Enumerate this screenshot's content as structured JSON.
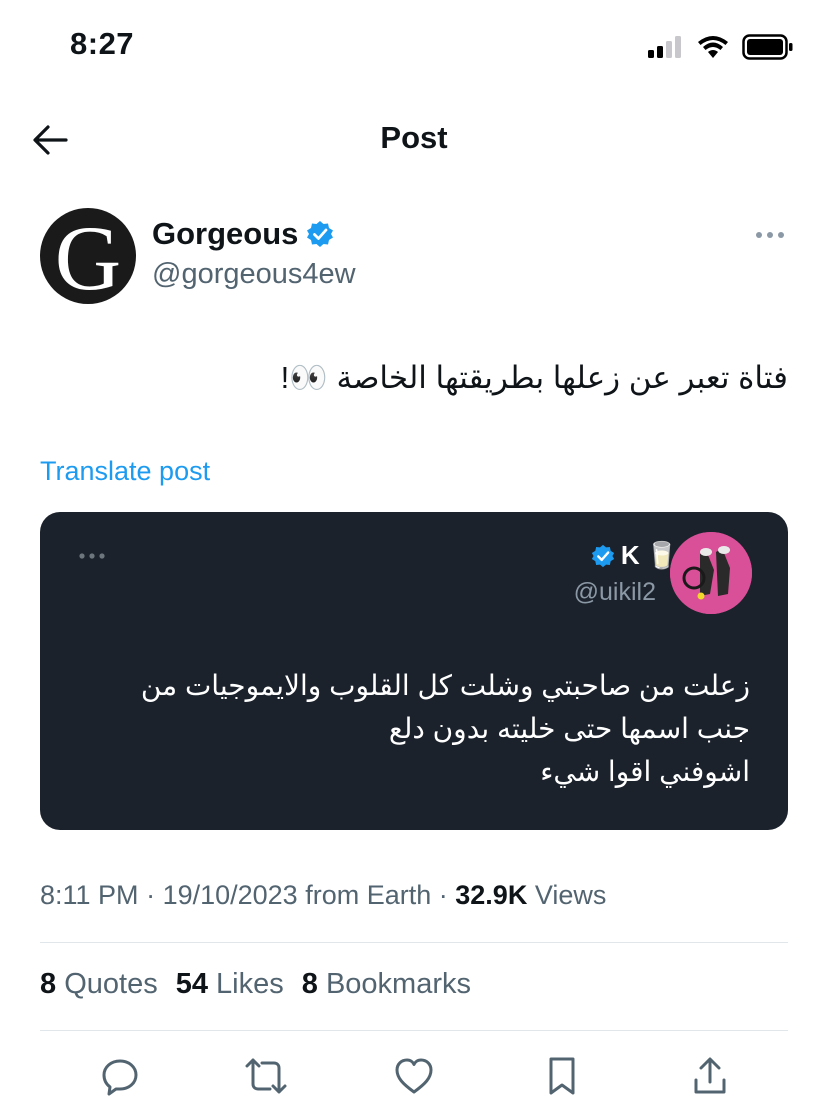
{
  "status_bar": {
    "time": "8:27"
  },
  "header": {
    "title": "Post"
  },
  "post": {
    "author": {
      "name": "Gorgeous",
      "handle": "@gorgeous4ew",
      "avatar_letter": "G"
    },
    "text": "فتاة تعبر عن زعلها بطريقتها الخاصة 👀!",
    "translate_label": "Translate post",
    "quoted": {
      "name": "K",
      "name_emoji": "🥛",
      "handle": "@uikil2",
      "lines": [
        "زعلت من صاحبتي وشلت كل القلوب والايموجيات من",
        "جنب اسمها حتى خليته بدون دلع",
        "اشوفني اقوا شيء"
      ]
    },
    "meta": {
      "time": "8:11 PM",
      "date": "19/10/2023",
      "source": "from Earth",
      "views_count": "32.9K",
      "views_label": "Views"
    },
    "stats": [
      {
        "count": "8",
        "label": "Quotes"
      },
      {
        "count": "54",
        "label": "Likes"
      },
      {
        "count": "8",
        "label": "Bookmarks"
      }
    ]
  },
  "icons": {
    "back": "arrow-left-icon",
    "verified": "verified-badge-icon",
    "more": "more-icon",
    "reply": "reply-icon",
    "repost": "repost-icon",
    "like": "heart-icon",
    "bookmark": "bookmark-icon",
    "share": "share-icon"
  },
  "colors": {
    "accent": "#1d9bf0",
    "card_bg": "#1b222c",
    "muted": "#536471"
  }
}
